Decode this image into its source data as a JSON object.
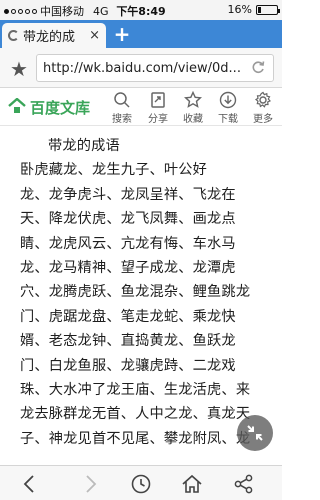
{
  "status_bar": {
    "carrier": "中国移动",
    "network": "4G",
    "time": "下午8:49",
    "battery_text": "16%",
    "battery_level": 0.16
  },
  "tab": {
    "title": "带龙的成",
    "close_label": "×",
    "new_tab_label": "+"
  },
  "address_bar": {
    "url": "http://wk.baidu.com/view/0d..."
  },
  "site_header": {
    "brand": "百度文库",
    "tools": [
      {
        "label": "搜索",
        "icon": "search-icon"
      },
      {
        "label": "分享",
        "icon": "share-icon"
      },
      {
        "label": "收藏",
        "icon": "star-icon"
      },
      {
        "label": "下载",
        "icon": "download-icon"
      },
      {
        "label": "更多",
        "icon": "gear-icon"
      }
    ]
  },
  "document": {
    "title": "带龙的成语",
    "lines": [
      "卧虎藏龙、龙生九子、叶公好",
      "龙、龙争虎斗、龙凤呈祥、飞龙在",
      "天、降龙伏虎、龙飞凤舞、画龙点",
      "睛、龙虎风云、亢龙有悔、车水马",
      "龙、龙马精神、望子成龙、龙潭虎",
      "穴、龙腾虎跃、鱼龙混杂、鲤鱼跳龙",
      "门、虎踞龙盘、笔走龙蛇、乘龙快",
      "婿、老态龙钟、直捣黄龙、鱼跃龙",
      "门、白龙鱼服、龙骧虎跱、二龙戏",
      "珠、大水冲了龙王庙、生龙活虎、来",
      "龙去脉群龙无首、人中之龙、真龙天",
      "子、神龙见首不见尾、攀龙附凤、龙"
    ]
  },
  "bottom_bar": {
    "icons": [
      "back-icon",
      "forward-icon",
      "history-icon",
      "home-icon",
      "share-icon"
    ]
  },
  "colors": {
    "tab_bar": "#3d87d6",
    "brand_green": "#3aa559"
  }
}
